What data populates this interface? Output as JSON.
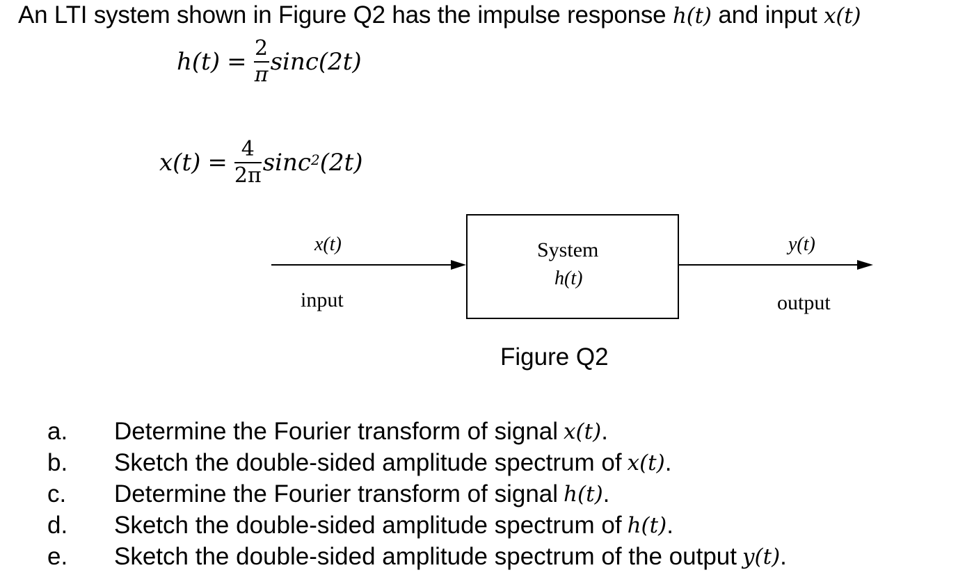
{
  "intro": {
    "text_before": "An LTI system shown in Figure Q2 has the impulse response",
    "symbol_h": "h(t)",
    "text_mid": "and input",
    "symbol_x": "x(t)"
  },
  "equations": {
    "h": {
      "lhs": "h(t)",
      "equals": "=",
      "numerator": "2",
      "denominator": "π",
      "function": "sinc(2t)"
    },
    "x": {
      "lhs": "x(t)",
      "equals": "=",
      "numerator": "4",
      "denominator": "2π",
      "function_name": "sinc",
      "exponent": "2",
      "argument": "(2t)"
    }
  },
  "diagram": {
    "input_signal": "x(t)",
    "input_label": "input",
    "system_label": "System",
    "system_function": "h(t)",
    "output_signal": "y(t)",
    "output_label": "output",
    "caption": "Figure Q2"
  },
  "questions": [
    {
      "letter": "a.",
      "text": "Determine the Fourier transform of signal",
      "symbol": "x(t)",
      "end": "."
    },
    {
      "letter": "b.",
      "text": "Sketch the double-sided amplitude spectrum of",
      "symbol": "x(t)",
      "end": "."
    },
    {
      "letter": "c.",
      "text": "Determine the Fourier transform of signal",
      "symbol": "h(t)",
      "end": "."
    },
    {
      "letter": "d.",
      "text": "Sketch the double-sided amplitude spectrum of",
      "symbol": "h(t)",
      "end": "."
    },
    {
      "letter": "e.",
      "text": "Sketch the double-sided amplitude spectrum of the output",
      "symbol": "y(t)",
      "end": "."
    }
  ]
}
